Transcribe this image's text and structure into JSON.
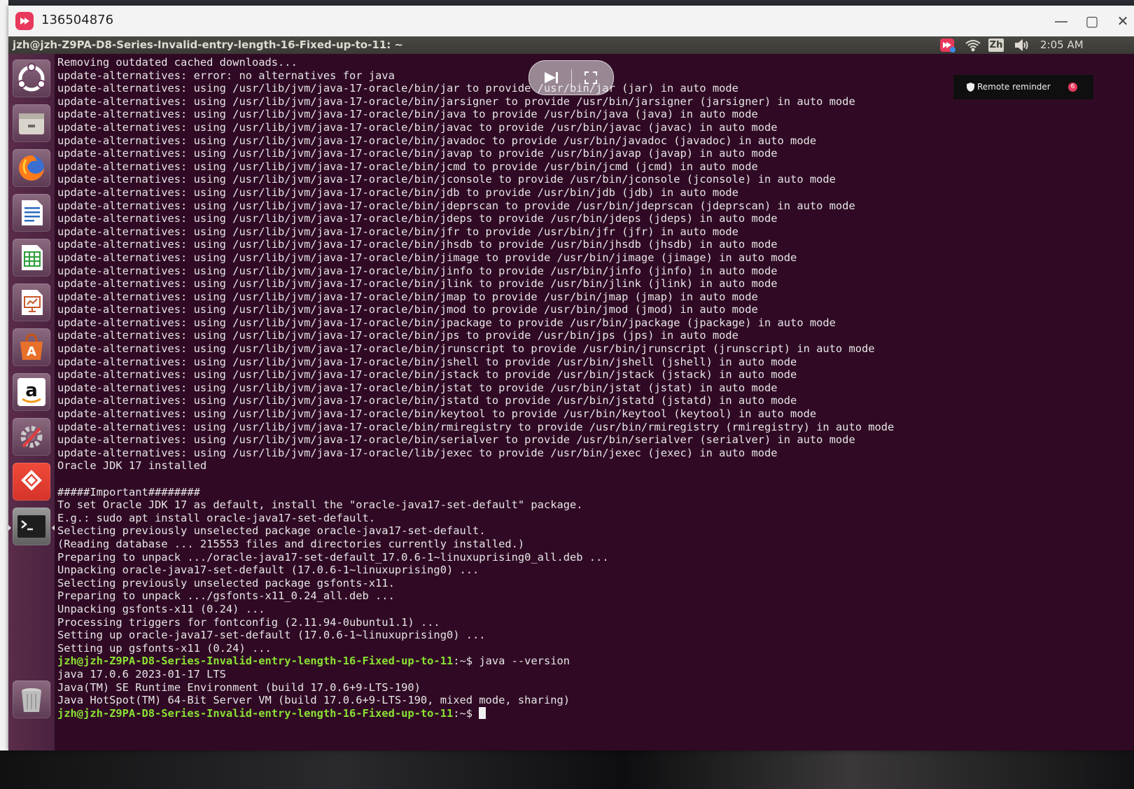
{
  "viewer": {
    "session_id": "136504876",
    "minimize": "—",
    "maximize": "▢",
    "close": "✕"
  },
  "topbar": {
    "title": "jzh@jzh-Z9PA-D8-Series-Invalid-entry-length-16-Fixed-up-to-11: ~",
    "input_method": "Zh",
    "clock": "2:05 AM"
  },
  "launcher": {
    "items": [
      "ubuntu-dash",
      "files",
      "firefox",
      "writer",
      "calc",
      "impress",
      "software-center",
      "amazon",
      "system-settings",
      "anydesk",
      "terminal",
      "trash"
    ]
  },
  "reminder": {
    "label": "Remote reminder",
    "count": "6"
  },
  "terminal": {
    "lines": [
      "Removing outdated cached downloads...",
      "update-alternatives: error: no alternatives for java",
      "update-alternatives: using /usr/lib/jvm/java-17-oracle/bin/jar to provide /usr/bin/jar (jar) in auto mode",
      "update-alternatives: using /usr/lib/jvm/java-17-oracle/bin/jarsigner to provide /usr/bin/jarsigner (jarsigner) in auto mode",
      "update-alternatives: using /usr/lib/jvm/java-17-oracle/bin/java to provide /usr/bin/java (java) in auto mode",
      "update-alternatives: using /usr/lib/jvm/java-17-oracle/bin/javac to provide /usr/bin/javac (javac) in auto mode",
      "update-alternatives: using /usr/lib/jvm/java-17-oracle/bin/javadoc to provide /usr/bin/javadoc (javadoc) in auto mode",
      "update-alternatives: using /usr/lib/jvm/java-17-oracle/bin/javap to provide /usr/bin/javap (javap) in auto mode",
      "update-alternatives: using /usr/lib/jvm/java-17-oracle/bin/jcmd to provide /usr/bin/jcmd (jcmd) in auto mode",
      "update-alternatives: using /usr/lib/jvm/java-17-oracle/bin/jconsole to provide /usr/bin/jconsole (jconsole) in auto mode",
      "update-alternatives: using /usr/lib/jvm/java-17-oracle/bin/jdb to provide /usr/bin/jdb (jdb) in auto mode",
      "update-alternatives: using /usr/lib/jvm/java-17-oracle/bin/jdeprscan to provide /usr/bin/jdeprscan (jdeprscan) in auto mode",
      "update-alternatives: using /usr/lib/jvm/java-17-oracle/bin/jdeps to provide /usr/bin/jdeps (jdeps) in auto mode",
      "update-alternatives: using /usr/lib/jvm/java-17-oracle/bin/jfr to provide /usr/bin/jfr (jfr) in auto mode",
      "update-alternatives: using /usr/lib/jvm/java-17-oracle/bin/jhsdb to provide /usr/bin/jhsdb (jhsdb) in auto mode",
      "update-alternatives: using /usr/lib/jvm/java-17-oracle/bin/jimage to provide /usr/bin/jimage (jimage) in auto mode",
      "update-alternatives: using /usr/lib/jvm/java-17-oracle/bin/jinfo to provide /usr/bin/jinfo (jinfo) in auto mode",
      "update-alternatives: using /usr/lib/jvm/java-17-oracle/bin/jlink to provide /usr/bin/jlink (jlink) in auto mode",
      "update-alternatives: using /usr/lib/jvm/java-17-oracle/bin/jmap to provide /usr/bin/jmap (jmap) in auto mode",
      "update-alternatives: using /usr/lib/jvm/java-17-oracle/bin/jmod to provide /usr/bin/jmod (jmod) in auto mode",
      "update-alternatives: using /usr/lib/jvm/java-17-oracle/bin/jpackage to provide /usr/bin/jpackage (jpackage) in auto mode",
      "update-alternatives: using /usr/lib/jvm/java-17-oracle/bin/jps to provide /usr/bin/jps (jps) in auto mode",
      "update-alternatives: using /usr/lib/jvm/java-17-oracle/bin/jrunscript to provide /usr/bin/jrunscript (jrunscript) in auto mode",
      "update-alternatives: using /usr/lib/jvm/java-17-oracle/bin/jshell to provide /usr/bin/jshell (jshell) in auto mode",
      "update-alternatives: using /usr/lib/jvm/java-17-oracle/bin/jstack to provide /usr/bin/jstack (jstack) in auto mode",
      "update-alternatives: using /usr/lib/jvm/java-17-oracle/bin/jstat to provide /usr/bin/jstat (jstat) in auto mode",
      "update-alternatives: using /usr/lib/jvm/java-17-oracle/bin/jstatd to provide /usr/bin/jstatd (jstatd) in auto mode",
      "update-alternatives: using /usr/lib/jvm/java-17-oracle/bin/keytool to provide /usr/bin/keytool (keytool) in auto mode",
      "update-alternatives: using /usr/lib/jvm/java-17-oracle/bin/rmiregistry to provide /usr/bin/rmiregistry (rmiregistry) in auto mode",
      "update-alternatives: using /usr/lib/jvm/java-17-oracle/bin/serialver to provide /usr/bin/serialver (serialver) in auto mode",
      "update-alternatives: using /usr/lib/jvm/java-17-oracle/lib/jexec to provide /usr/bin/jexec (jexec) in auto mode",
      "Oracle JDK 17 installed",
      "",
      "#####Important########",
      "To set Oracle JDK 17 as default, install the \"oracle-java17-set-default\" package.",
      "E.g.: sudo apt install oracle-java17-set-default.",
      "Selecting previously unselected package oracle-java17-set-default.",
      "(Reading database ... 215553 files and directories currently installed.)",
      "Preparing to unpack .../oracle-java17-set-default_17.0.6-1~linuxuprising0_all.deb ...",
      "Unpacking oracle-java17-set-default (17.0.6-1~linuxuprising0) ...",
      "Selecting previously unselected package gsfonts-x11.",
      "Preparing to unpack .../gsfonts-x11_0.24_all.deb ...",
      "Unpacking gsfonts-x11 (0.24) ...",
      "Processing triggers for fontconfig (2.11.94-0ubuntu1.1) ...",
      "Setting up oracle-java17-set-default (17.0.6-1~linuxuprising0) ...",
      "Setting up gsfonts-x11 (0.24) ..."
    ],
    "prompt1": {
      "user_host": "jzh@jzh-Z9PA-D8-Series-Invalid-entry-length-16-Fixed-up-to-11",
      "path": ":~$ ",
      "command": "java --version"
    },
    "output_lines": [
      "java 17.0.6 2023-01-17 LTS",
      "Java(TM) SE Runtime Environment (build 17.0.6+9-LTS-190)",
      "Java HotSpot(TM) 64-Bit Server VM (build 17.0.6+9-LTS-190, mixed mode, sharing)"
    ],
    "prompt2": {
      "user_host": "jzh@jzh-Z9PA-D8-Series-Invalid-entry-length-16-Fixed-up-to-11",
      "path": ":~$ "
    }
  },
  "colors": {
    "terminal_bg": "#300a24",
    "prompt_green": "#8ae234",
    "accent_pink": "#e8385b"
  }
}
